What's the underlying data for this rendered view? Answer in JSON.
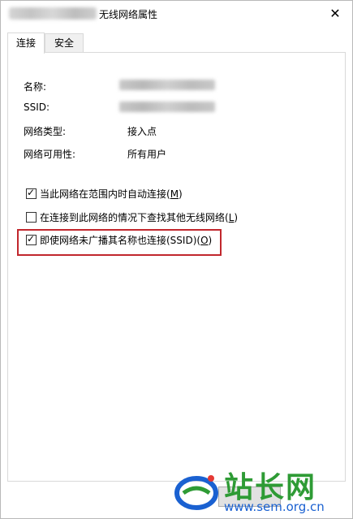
{
  "window": {
    "title": "无线网络属性",
    "close_glyph": "✕"
  },
  "tabs": [
    {
      "label": "连接",
      "active": true
    },
    {
      "label": "安全",
      "active": false
    }
  ],
  "properties": {
    "name_label": "名称:",
    "ssid_label": "SSID:",
    "type_label": "网络类型:",
    "type_value": "接入点",
    "availability_label": "网络可用性:",
    "availability_value": "所有用户"
  },
  "options": [
    {
      "text": "当此网络在范围内时自动连接(",
      "key": "M",
      "tail": ")",
      "checked": true
    },
    {
      "text": "在连接到此网络的情况下查找其他无线网络(",
      "key": "L",
      "tail": ")",
      "checked": false
    },
    {
      "text": "即使网络未广播其名称也连接(SSID)(",
      "key": "O",
      "tail": ")",
      "checked": true
    }
  ],
  "watermark": {
    "title": "站长网",
    "url": "www.sem.org.cn"
  },
  "colors": {
    "highlight": "#c1272d",
    "watermark_green": "#2e9b35",
    "watermark_blue": "#1a61d1"
  }
}
